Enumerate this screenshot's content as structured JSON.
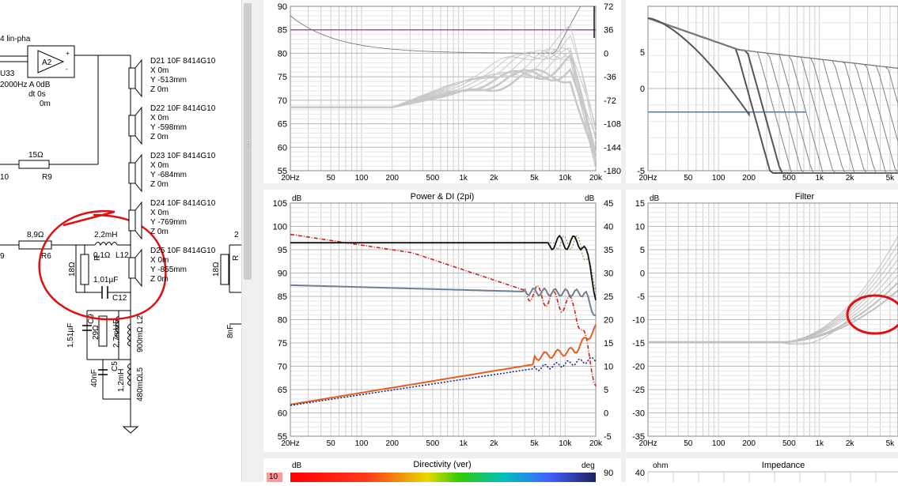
{
  "schematic": {
    "amp_label": "A2",
    "amp_title": "4 lin-pha",
    "amp_info": [
      "2000Hz A  0dB",
      "dt 0s",
      "0m"
    ],
    "amp_ref": "U33",
    "r9": {
      "value": "15Ω",
      "name": "R9"
    },
    "r6": {
      "value": "8,9Ω",
      "name": "R6"
    },
    "r_left_cut": "10",
    "r_left_cut2": "9",
    "drivers": [
      {
        "name": "D21 10F 8414G10",
        "x": "X 0m",
        "y": "Y -513mm",
        "z": "Z 0m"
      },
      {
        "name": "D22 10F 8414G10",
        "x": "X 0m",
        "y": "Y -598mm",
        "z": "Z 0m"
      },
      {
        "name": "D23 10F 8414G10",
        "x": "X 0m",
        "y": "Y -684mm",
        "z": "Z 0m"
      },
      {
        "name": "D24 10F 8414G10",
        "x": "X 0m",
        "y": "Y -769mm",
        "z": "Z 0m"
      },
      {
        "name": "D25 10F 8414G10",
        "x": "X 0m",
        "y": "Y -855mm",
        "z": "Z 0m"
      }
    ],
    "l12": {
      "value": "2,2mH",
      "name": "L12",
      "res": "0,1Ω"
    },
    "r_18": {
      "value": "18Ω",
      "name": "R"
    },
    "c12": {
      "value": "1,01µF",
      "name": "C12"
    },
    "c_left": {
      "value": "1,51µF",
      "name": "C9"
    },
    "r_29": {
      "value": "29Ω",
      "name": "R"
    },
    "l_27": {
      "value": "2,7mH",
      "name": "L"
    },
    "l_900": {
      "value": "900mΩ",
      "name": "L2"
    },
    "c5": {
      "value": "40nF",
      "name": "C5"
    },
    "l5": {
      "value": "1,2mH",
      "name": "L5",
      "res": "480mΩ"
    },
    "right_r": "18Ω",
    "right_r_name": "R",
    "right_c": "8nF",
    "right_cut": "2"
  },
  "panels": {
    "spl": {
      "y_ticks": [
        "90",
        "85",
        "80",
        "75",
        "70",
        "65",
        "60",
        "55"
      ],
      "phase_ticks": [
        "72",
        "36",
        "0",
        "-36",
        "-72",
        "-108",
        "-144",
        "-180"
      ],
      "x_ticks": [
        "20Hz",
        "50",
        "100",
        "200",
        "500",
        "1k",
        "2k",
        "5k",
        "10k",
        "20k"
      ]
    },
    "spl_right": {
      "y_ticks": [
        "5",
        "0",
        "-5"
      ],
      "x_ticks": [
        "20Hz",
        "50",
        "100",
        "200",
        "500",
        "1k",
        "2k",
        "5k"
      ]
    },
    "power_di": {
      "title": "Power & DI (2pi)",
      "left_unit": "dB",
      "right_unit": "dB",
      "y_ticks": [
        "105",
        "100",
        "95",
        "90",
        "85",
        "80",
        "75",
        "70",
        "65",
        "60",
        "55"
      ],
      "di_ticks": [
        "45",
        "40",
        "35",
        "30",
        "25",
        "20",
        "15",
        "10",
        "5",
        "0",
        "-5"
      ],
      "x_ticks": [
        "20Hz",
        "50",
        "100",
        "200",
        "500",
        "1k",
        "2k",
        "5k",
        "10k",
        "20k"
      ]
    },
    "filter": {
      "title": "Filter",
      "unit": "dB",
      "y_ticks": [
        "15",
        "10",
        "5",
        "0",
        "-5",
        "-10",
        "-15",
        "-20",
        "-25",
        "-30",
        "-35"
      ],
      "x_ticks": [
        "20Hz",
        "50",
        "100",
        "200",
        "500",
        "1k",
        "2k",
        "5k"
      ]
    },
    "directivity": {
      "title": "Directivity (ver)",
      "left_unit": "dB",
      "right_unit": "deg",
      "left_tick": "10",
      "right_tick": "90"
    },
    "impedance": {
      "title": "Impedance",
      "unit": "ohm",
      "left_tick": "40"
    }
  },
  "colors": {
    "annotation_red": "#e01010",
    "pink_line": "#c040c0",
    "power_black": "#111111",
    "di_red": "#cc2222",
    "axial_grey": "#6e7f8f",
    "orange": "#e06020",
    "navy": "#1a1a7a",
    "filter_blue": "#4a7ab0"
  },
  "icons": {
    "amp": "amplifier-triangle-icon",
    "speaker": "speaker-driver-icon",
    "ground": "ground-icon"
  }
}
